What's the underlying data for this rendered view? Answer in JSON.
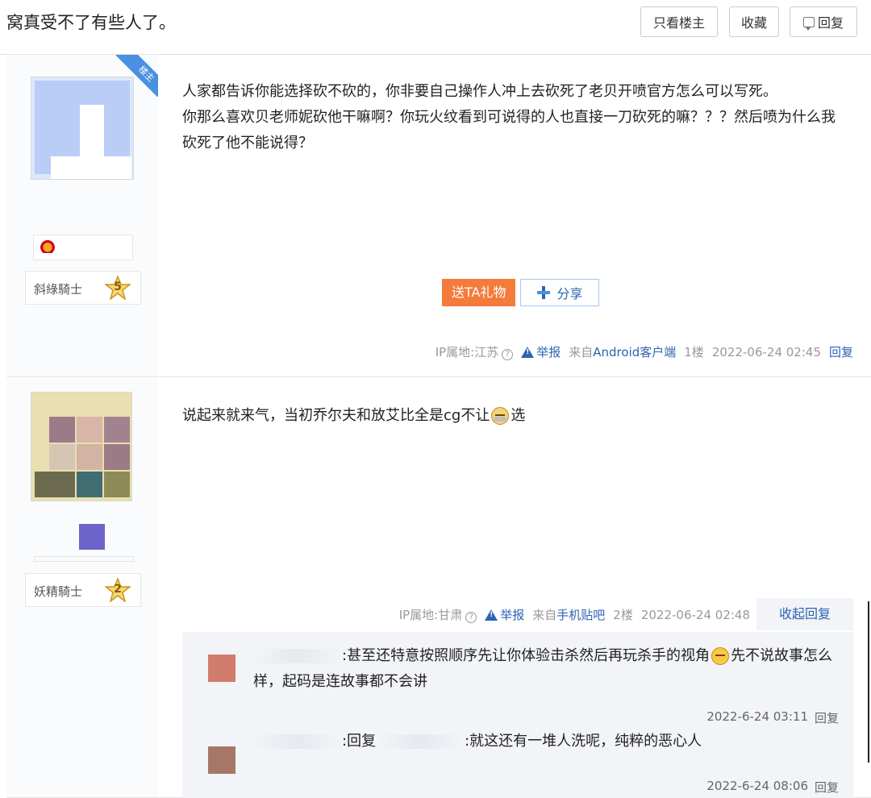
{
  "thread": {
    "title": "窝真受不了有些人了。",
    "buttons": {
      "only_op": "只看楼主",
      "favorite": "收藏",
      "reply": "回复"
    }
  },
  "posts": [
    {
      "op_badge": "楼主",
      "level_name": "斜綠騎士",
      "level": "5",
      "content_lines": [
        "人家都告诉你能选择砍不砍的，你非要自己操作人冲上去砍死了老贝开喷官方怎么可以写死。",
        "你那么喜欢贝老师妮砍他干嘛啊？你玩火纹看到可说得的人也直接一刀砍死的嘛？？？然后喷为什么我砍死了他不能说得？"
      ],
      "gift_button": "送TA礼物",
      "share_button": "分享",
      "meta": {
        "ip": "IP属地:江苏",
        "report": "举报",
        "source_prefix": "来自",
        "source": "Android客户端",
        "floor": "1楼",
        "time": "2022-06-24 02:45",
        "reply": "回复"
      }
    },
    {
      "level_name": "妖精騎士",
      "level": "2",
      "content_before": "说起来就来气，当初乔尔夫和放艾比全是cg不让",
      "content_after": "选",
      "meta": {
        "ip": "IP属地:甘肃",
        "report": "举报",
        "source_prefix": "来自",
        "source": "手机贴吧",
        "floor": "2楼",
        "time": "2022-06-24 02:48",
        "collapse": "收起回复"
      },
      "comments": [
        {
          "text_before": ":甚至还特意按照顺序先让你体验击杀然后再玩杀手的视角",
          "text_after": "先不说故事怎么样，起码是连故事都不会讲",
          "time": "2022-6-24 03:11",
          "reply": "回复"
        },
        {
          "reply_prefix": ":回复",
          "text": ":就这还有一堆人洗呢，纯粹的恶心人",
          "time": "2022-6-24 08:06",
          "reply": "回复"
        }
      ]
    }
  ],
  "icons": {
    "reply": "comment-icon",
    "help": "question-icon",
    "report": "warning-icon",
    "share": "plus-icon",
    "emoji": "smiley-icon"
  },
  "colors": {
    "link": "#2d64b3",
    "gift": "#f47b3a",
    "op_badge": "#4a90e2"
  }
}
